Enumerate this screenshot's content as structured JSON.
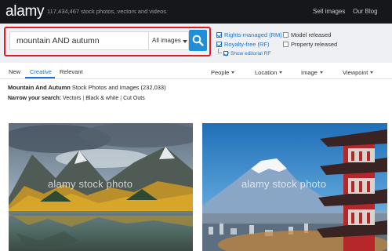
{
  "header": {
    "logo": "alamy",
    "tagline": "117,434,467 stock photos, vectors and videos",
    "links": [
      "Sell images",
      "Our Blog"
    ]
  },
  "search": {
    "query": "mountain AND autumn",
    "filter_value": "All images",
    "highlight_color": "#e21b23",
    "button_color": "#1e8fd9",
    "button_icon": "search-icon"
  },
  "options": {
    "rights_managed": {
      "label": "Rights-managed (RM)",
      "checked": true
    },
    "royalty_free": {
      "label": "Royalty-free (RF)",
      "checked": true
    },
    "editorial_rf": {
      "label": "Show editorial RF",
      "checked": true
    },
    "model_released": {
      "label": "Model released",
      "checked": false
    },
    "property_released": {
      "label": "Property released",
      "checked": false
    }
  },
  "tabs": [
    {
      "label": "New",
      "active": false
    },
    {
      "label": "Creative",
      "active": true
    },
    {
      "label": "Relevant",
      "active": false
    }
  ],
  "dropdowns": [
    "People",
    "Location",
    "Image",
    "Viewpoint"
  ],
  "results": {
    "title_bold": "Mountain And Autumn",
    "title_rest": " Stock Photos and Images (232,033)"
  },
  "narrow": {
    "label": "Narrow your search:",
    "items": [
      "Vectors",
      "Black & white",
      "Cut Outs"
    ]
  },
  "images": [
    {
      "subject": "autumn mountain lake reflection",
      "watermark": "alamy stock photo"
    },
    {
      "subject": "pagoda with snow-capped mountain",
      "watermark": "alamy stock photo"
    }
  ],
  "accent_color": "#1e73c8"
}
